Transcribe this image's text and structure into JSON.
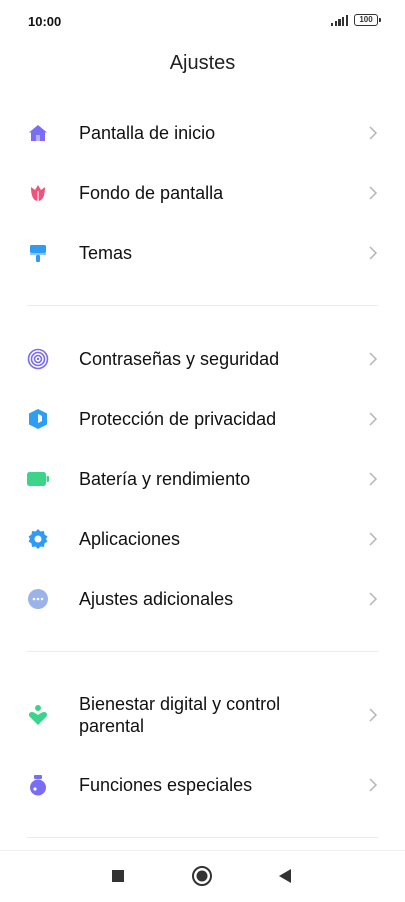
{
  "status_bar": {
    "time": "10:00",
    "battery": "100"
  },
  "header": {
    "title": "Ajustes"
  },
  "settings": {
    "group1": [
      {
        "label": "Pantalla de inicio",
        "icon": "home-icon",
        "color": "#7b6cf6"
      },
      {
        "label": "Fondo de pantalla",
        "icon": "tulip-icon",
        "color": "#f0547c"
      },
      {
        "label": "Temas",
        "icon": "paintbrush-icon",
        "color": "#2f9bf5"
      }
    ],
    "group2": [
      {
        "label": "Contraseñas y seguridad",
        "icon": "fingerprint-icon",
        "color": "#7a6af0"
      },
      {
        "label": "Protección de privacidad",
        "icon": "shield-icon",
        "color": "#2d9ef4"
      },
      {
        "label": "Batería y rendimiento",
        "icon": "battery-icon",
        "color": "#3cd48a"
      },
      {
        "label": "Aplicaciones",
        "icon": "gear-icon",
        "color": "#2f9bf5"
      },
      {
        "label": "Ajustes adicionales",
        "icon": "more-icon",
        "color": "#9bb3e8"
      }
    ],
    "group3": [
      {
        "label": "Bienestar digital y control parental",
        "icon": "wellbeing-icon",
        "color": "#3cd48a"
      },
      {
        "label": "Funciones especiales",
        "icon": "potion-icon",
        "color": "#7b6cf6"
      }
    ]
  },
  "nav": {
    "recents": "recents-square-icon",
    "home": "home-circle-icon",
    "back": "back-triangle-icon"
  }
}
